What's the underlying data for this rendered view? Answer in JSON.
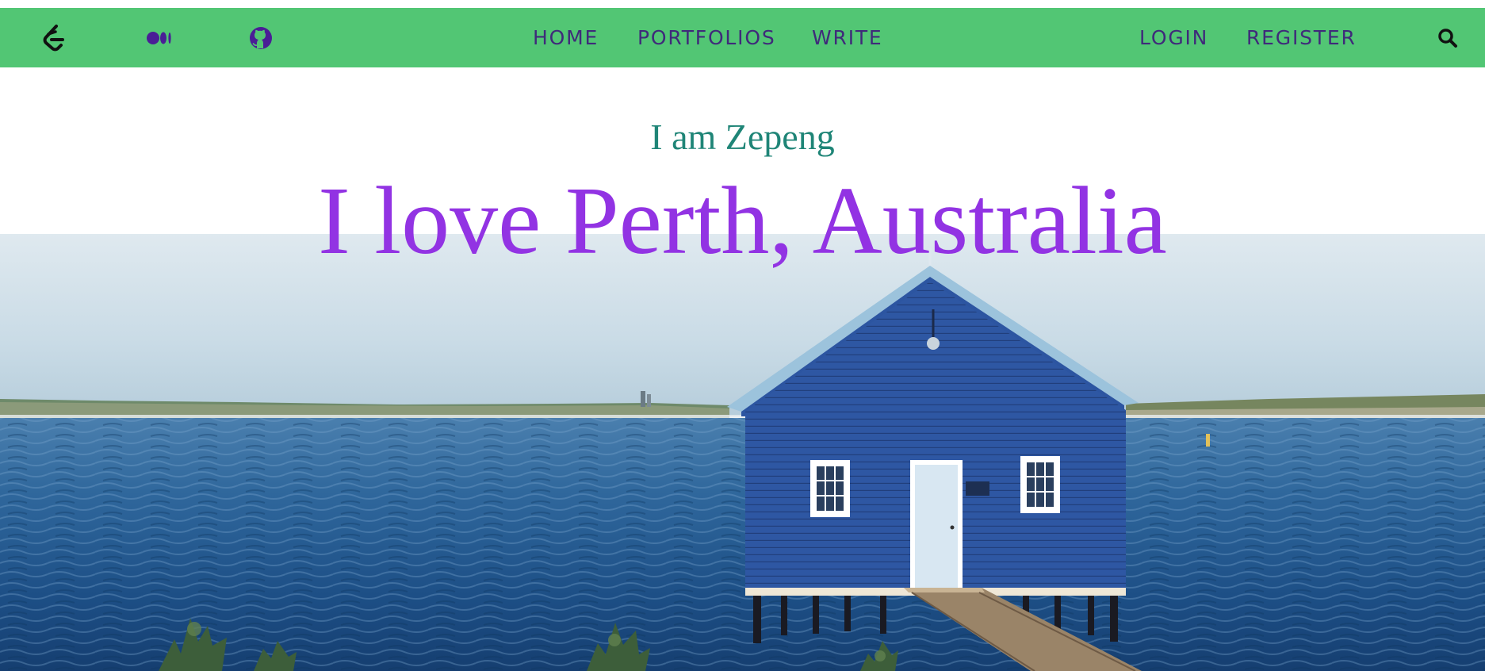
{
  "nav": {
    "icons": {
      "logo": "leetcode-icon",
      "medium": "medium-icon",
      "github": "github-icon",
      "search": "search-icon"
    },
    "center_links": [
      "HOME",
      "PORTFOLIOS",
      "WRITE"
    ],
    "right_links": [
      "LOGIN",
      "REGISTER"
    ]
  },
  "hero": {
    "subtitle": "I am Zepeng",
    "headline": "I love Perth, Australia",
    "image": "boathouse-on-river-photo"
  },
  "colors": {
    "navbar_bg": "#52c674",
    "nav_text": "#3f2a7a",
    "subtitle": "#1f8577",
    "headline": "#9233e3"
  }
}
